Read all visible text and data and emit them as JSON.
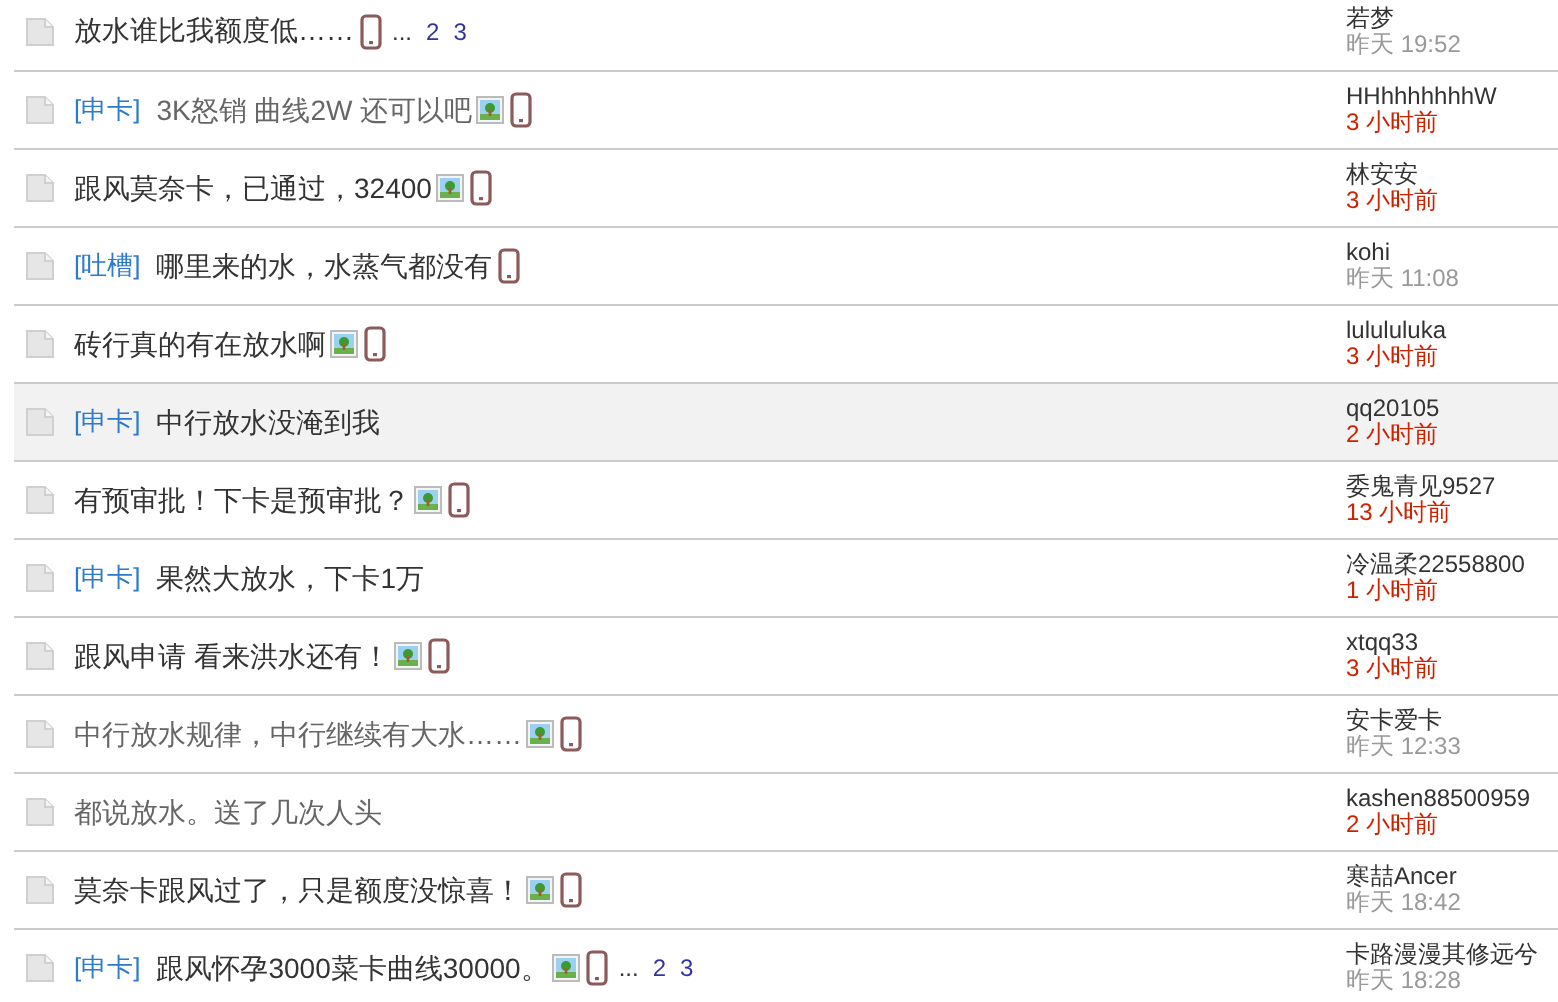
{
  "threads": [
    {
      "title": "放水谁比我额度低……",
      "visited": false,
      "has_image": false,
      "mobile": true,
      "ellipsis": "...",
      "pages": [
        "2",
        "3"
      ],
      "author": "若梦",
      "time": "昨天 19:52",
      "recent": false,
      "highlighted": false
    },
    {
      "tag": "[申卡]",
      "title": "3K怒销 曲线2W 还可以吧",
      "visited": true,
      "has_image": true,
      "mobile": true,
      "author": "HHhhhhhhhW",
      "time": "3 小时前",
      "recent": true,
      "highlighted": false
    },
    {
      "title": "跟风莫奈卡，已通过，32400",
      "visited": false,
      "has_image": true,
      "mobile": true,
      "author": "林安安",
      "time": "3 小时前",
      "recent": true,
      "highlighted": false
    },
    {
      "tag": "[吐槽]",
      "title": "哪里来的水，水蒸气都没有",
      "visited": false,
      "has_image": false,
      "mobile": true,
      "author": "kohi",
      "time": "昨天 11:08",
      "recent": false,
      "highlighted": false
    },
    {
      "title": "砖行真的有在放水啊",
      "visited": false,
      "has_image": true,
      "mobile": true,
      "author": "lulululuka",
      "time": "3 小时前",
      "recent": true,
      "highlighted": false
    },
    {
      "tag": "[申卡]",
      "title": "中行放水没淹到我",
      "visited": false,
      "has_image": false,
      "mobile": false,
      "author": "qq20105",
      "time": "2 小时前",
      "recent": true,
      "highlighted": true
    },
    {
      "title": "有预审批！下卡是预审批？",
      "visited": false,
      "has_image": true,
      "mobile": true,
      "author": "委鬼青见9527",
      "time": "13 小时前",
      "recent": true,
      "highlighted": false
    },
    {
      "tag": "[申卡]",
      "title": "果然大放水，下卡1万",
      "visited": false,
      "has_image": false,
      "mobile": false,
      "author": "冷温柔22558800",
      "time": "1 小时前",
      "recent": true,
      "highlighted": false
    },
    {
      "title": "跟风申请 看来洪水还有！",
      "visited": false,
      "has_image": true,
      "mobile": true,
      "author": "xtqq33",
      "time": "3 小时前",
      "recent": true,
      "highlighted": false
    },
    {
      "title": "中行放水规律，中行继续有大水……",
      "visited": true,
      "has_image": true,
      "mobile": true,
      "author": "安卡爱卡",
      "time": "昨天 12:33",
      "recent": false,
      "highlighted": false
    },
    {
      "title": "都说放水。送了几次人头",
      "visited": true,
      "has_image": false,
      "mobile": false,
      "author": "kashen88500959",
      "time": "2 小时前",
      "recent": true,
      "highlighted": false
    },
    {
      "title": "莫奈卡跟风过了，只是额度没惊喜！",
      "visited": false,
      "has_image": true,
      "mobile": true,
      "author": "寒喆Ancer",
      "time": "昨天 18:42",
      "recent": false,
      "highlighted": false
    },
    {
      "tag": "[申卡]",
      "title": "跟风怀孕3000菜卡曲线30000。",
      "visited": false,
      "has_image": true,
      "mobile": true,
      "ellipsis": "...",
      "pages": [
        "2",
        "3"
      ],
      "author": "卡路漫漫其修远兮",
      "time": "昨天 18:28",
      "recent": false,
      "highlighted": false
    }
  ]
}
